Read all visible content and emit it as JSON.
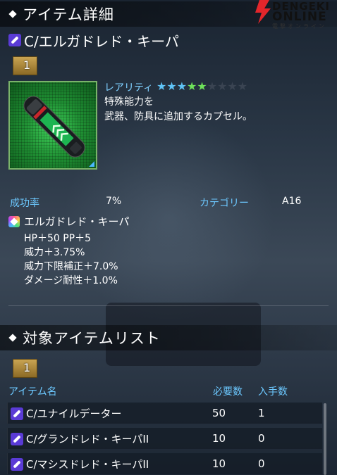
{
  "header": {
    "title": "アイテム詳細",
    "logo_line1": "DENGEKI",
    "logo_line2": "ONLINE",
    "logo_line3": "電撃オンライン"
  },
  "item": {
    "name": "C/エルガドレド・キーパ",
    "quantity": "1",
    "rarity_label": "レアリティ",
    "rarity_stars": 5,
    "rarity_max": 9,
    "description": "特殊能力を\n武器、防具に追加するカプセル。",
    "success_label": "成功率",
    "success_value": "7%",
    "category_label": "カテゴリー",
    "category_value": "A16"
  },
  "effect": {
    "name": "エルガドレド・キーパ",
    "lines": [
      "HP＋50 PP＋5",
      "威力＋3.75%",
      "威力下限補正＋7.0%",
      "ダメージ耐性＋1.0%"
    ]
  },
  "target_list": {
    "title": "対象アイテムリスト",
    "quantity": "1",
    "columns": {
      "name": "アイテム名",
      "required": "必要数",
      "owned": "入手数"
    },
    "rows": [
      {
        "name": "C/ユナイルデーター",
        "required": "50",
        "owned": "1"
      },
      {
        "name": "C/グランドレド・キーパII",
        "required": "10",
        "owned": "0"
      },
      {
        "name": "C/マシスドレド・キーパII",
        "required": "10",
        "owned": "0"
      }
    ]
  },
  "colors": {
    "accent": "#6cc8ff",
    "star_on": "#5fc3f5",
    "star_green": "#6ee25a",
    "badge": "#c9a452",
    "logo_red": "#e3262b"
  }
}
